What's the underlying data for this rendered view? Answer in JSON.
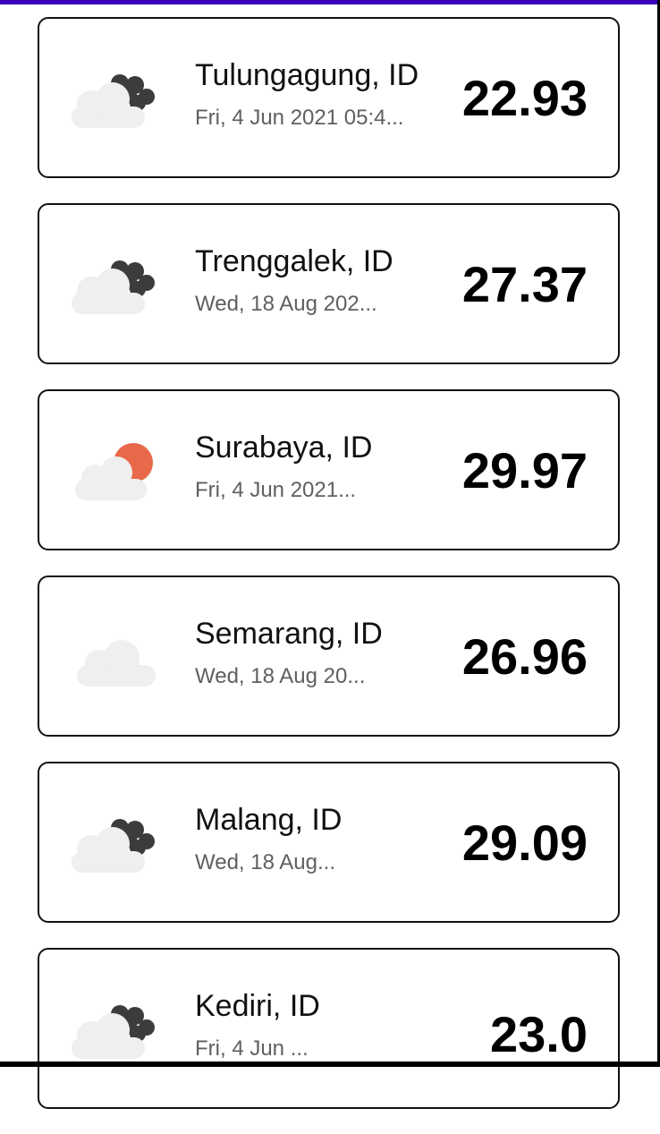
{
  "cards": [
    {
      "city": "Tulungagung, ID",
      "date": "Fri, 4 Jun 2021 05:4...",
      "temp": "22.93",
      "icon": "cloudy-icon"
    },
    {
      "city": "Trenggalek, ID",
      "date": "Wed, 18 Aug 202...",
      "temp": "27.37",
      "icon": "cloudy-icon"
    },
    {
      "city": "Surabaya, ID",
      "date": "Fri, 4 Jun 2021...",
      "temp": "29.97",
      "icon": "partly-sunny-icon"
    },
    {
      "city": "Semarang, ID",
      "date": "Wed, 18 Aug 20...",
      "temp": "26.96",
      "icon": "cloud-icon"
    },
    {
      "city": "Malang, ID",
      "date": "Wed, 18 Aug...",
      "temp": "29.09",
      "icon": "cloudy-icon"
    },
    {
      "city": "Kediri, ID",
      "date": "Fri, 4 Jun ...",
      "temp": "23.0",
      "icon": "cloudy-icon"
    }
  ],
  "colors": {
    "top_bar": "#3a00b8",
    "dark_cloud": "#3c3c3c",
    "light_cloud": "#efefef",
    "sun": "#e8694a"
  }
}
